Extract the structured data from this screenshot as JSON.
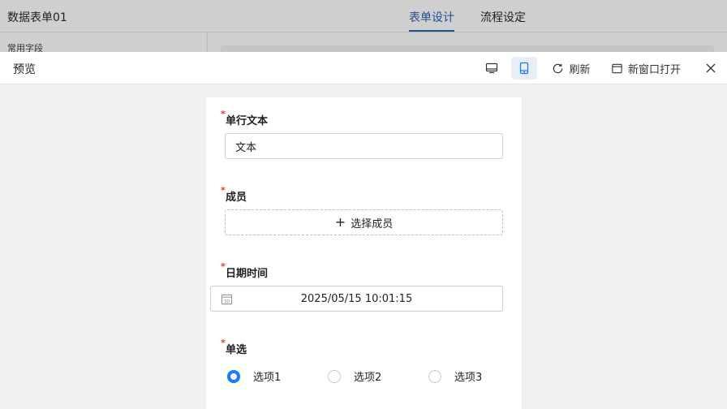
{
  "app": {
    "form_title": "数据表单01",
    "tabs": [
      {
        "label": "表单设计",
        "active": true
      },
      {
        "label": "流程设定",
        "active": false
      }
    ],
    "sidebar_group_label": "常用字段"
  },
  "preview": {
    "title": "预览",
    "toolbar": {
      "desktop_icon": "monitor-icon",
      "mobile_icon": "mobile-icon",
      "refresh_label": "刷新",
      "open_window_label": "新窗口打开",
      "close_icon": "close-icon",
      "active_view": "mobile"
    }
  },
  "form": {
    "required_mark": "*",
    "fields": [
      {
        "label": "单行文本",
        "value": "文本"
      },
      {
        "label": "成员",
        "button_label": "选择成员"
      },
      {
        "label": "日期时间",
        "value": "2025/05/15  10:01:15"
      },
      {
        "label": "单选",
        "options": [
          "选项1",
          "选项2",
          "选项3"
        ],
        "selected_index": 0
      }
    ]
  },
  "colors": {
    "accent": "#1677ff",
    "required": "#e53935",
    "tab_active": "#1f4f8f"
  }
}
